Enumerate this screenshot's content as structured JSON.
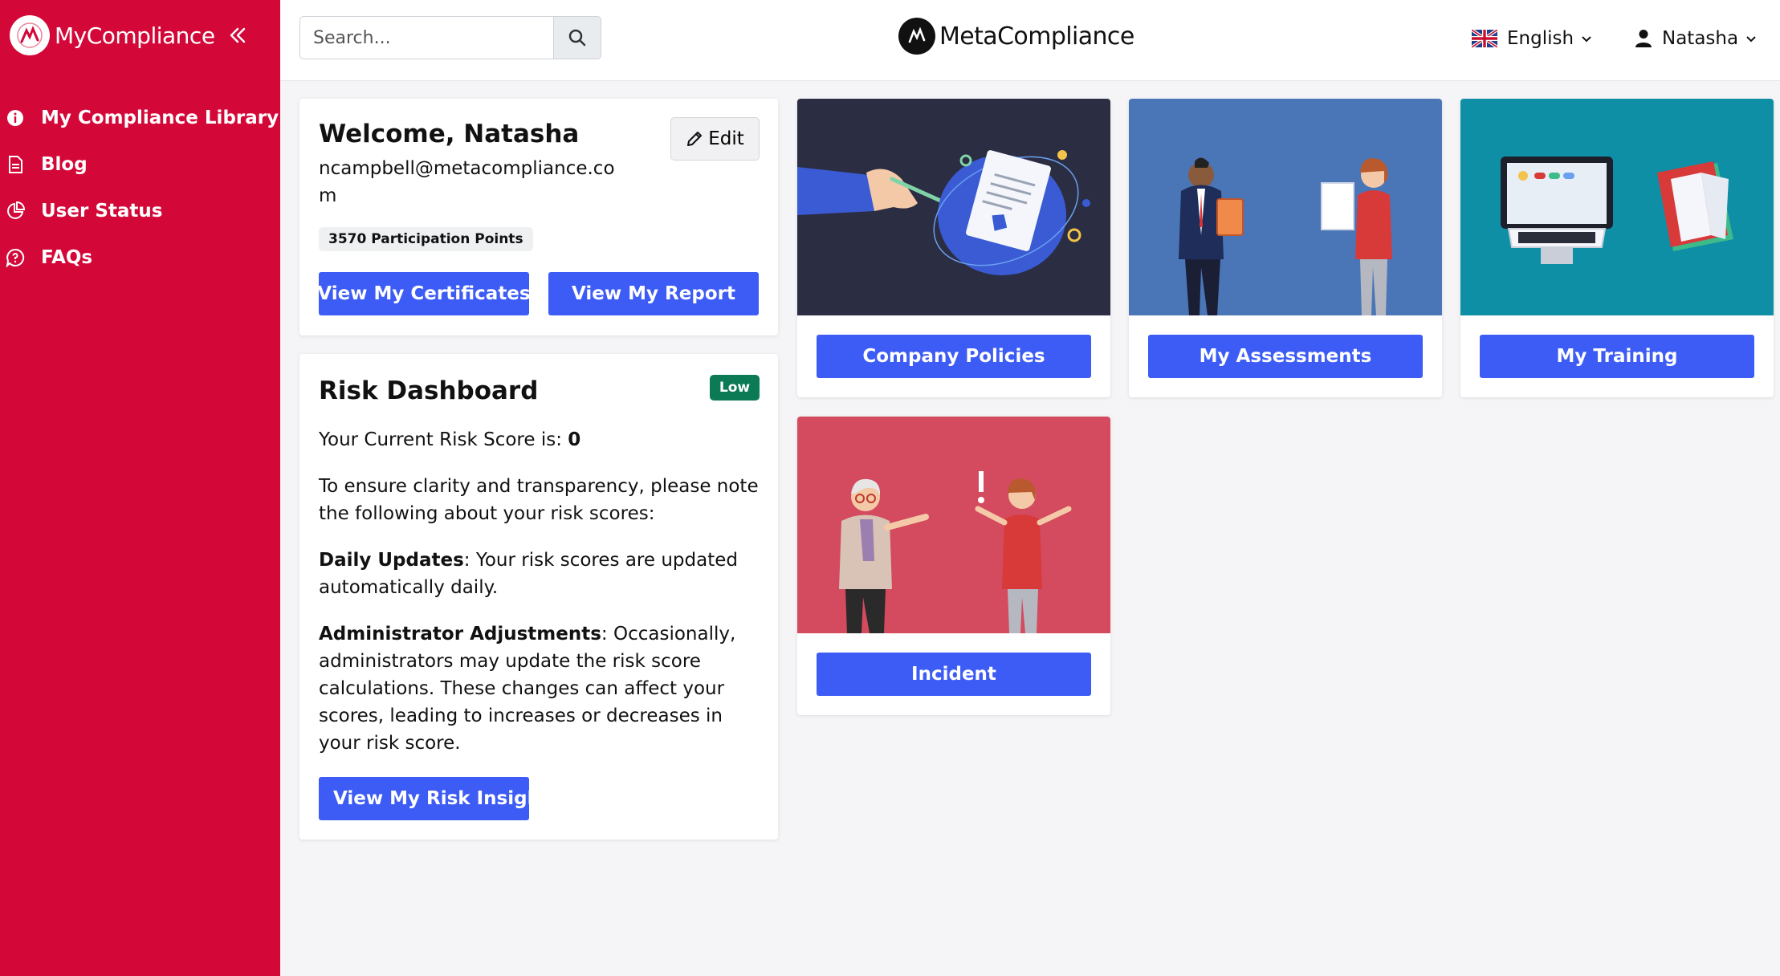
{
  "app": {
    "brand_name": "MyCompliance",
    "center_brand": "MetaCompliance",
    "accent_color": "#d30838",
    "primary_button_color": "#3d5cf5"
  },
  "sidebar": {
    "items": [
      {
        "label": "My Compliance Library",
        "icon": "info-circle-icon"
      },
      {
        "label": "Blog",
        "icon": "document-icon"
      },
      {
        "label": "User Status",
        "icon": "pie-chart-icon"
      },
      {
        "label": "FAQs",
        "icon": "question-bubble-icon"
      }
    ]
  },
  "header": {
    "search_placeholder": "Search...",
    "language": "English",
    "user_name": "Natasha"
  },
  "welcome": {
    "title": "Welcome, Natasha",
    "email": "ncampbell@metacompliance.com",
    "edit_label": "Edit",
    "points": "3570 Participation Points",
    "certificate_button": "View My Certificates",
    "report_button": "View My Report"
  },
  "risk": {
    "title": "Risk Dashboard",
    "badge": "Low",
    "score_prefix": "Your Current Risk Score is: ",
    "score_value": "0",
    "intro": "To ensure clarity and transparency, please note the following about your risk scores:",
    "daily_title": "Daily Updates",
    "daily_text": ": Your risk scores are updated automatically daily.",
    "admin_title": "Administrator Adjustments",
    "admin_text": ": Occasionally, administrators may update the risk score calculations. These changes can affect your scores, leading to increases or decreases in your risk score.",
    "insights_button": "View My Risk Insights"
  },
  "tiles": [
    {
      "label": "Company Policies",
      "bg": "#2b2d42"
    },
    {
      "label": "My Assessments",
      "bg": "#4a76b8"
    },
    {
      "label": "My Training",
      "bg": "#0e8fa6"
    },
    {
      "label": "Incident",
      "bg": "#d44a5e"
    }
  ]
}
